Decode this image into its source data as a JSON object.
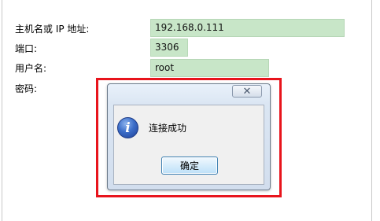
{
  "form": {
    "host_label": "主机名或 IP 地址:",
    "host_value": "192.168.0.111",
    "port_label": "端口:",
    "port_value": "3306",
    "user_label": "用户名:",
    "user_value": "root",
    "password_label": "密码:"
  },
  "dialog": {
    "message": "连接成功",
    "ok_label": "确定",
    "icon": "info-icon"
  },
  "colors": {
    "field_background": "#c8e6c8",
    "highlight": "#e8141c"
  }
}
